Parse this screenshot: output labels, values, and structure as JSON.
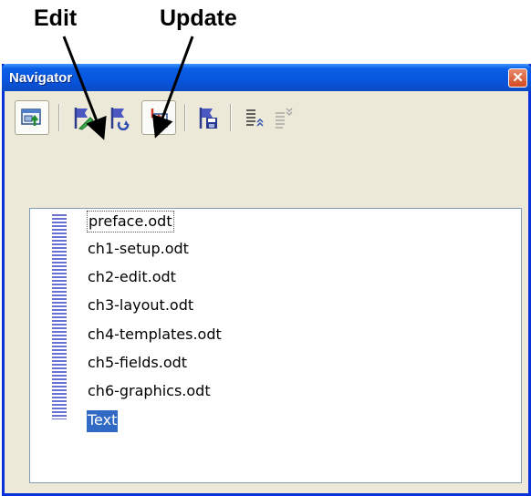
{
  "callouts": {
    "edit": "Edit",
    "update": "Update"
  },
  "window": {
    "title": "Navigator",
    "close_glyph": "✕"
  },
  "toolbar": {
    "buttons": [
      {
        "icon": "toggle-icon",
        "pressed": true
      },
      {
        "icon": "edit-flag-icon"
      },
      {
        "icon": "update-flag-icon"
      },
      {
        "icon": "insert-icon",
        "pressed": true
      },
      {
        "icon": "save-flag-icon"
      },
      {
        "icon": "promote-icon"
      },
      {
        "icon": "demote-icon"
      }
    ]
  },
  "documents": [
    {
      "label": "preface.odt",
      "focused": true
    },
    {
      "label": "ch1-setup.odt"
    },
    {
      "label": "ch2-edit.odt"
    },
    {
      "label": "ch3-layout.odt"
    },
    {
      "label": "ch4-templates.odt"
    },
    {
      "label": "ch5-fields.odt"
    },
    {
      "label": "ch6-graphics.odt"
    },
    {
      "label": "Text",
      "selected": true
    }
  ],
  "colors": {
    "title_bar": "#0855dd",
    "selection": "#316ac5",
    "window_bg": "#ece9d8"
  }
}
